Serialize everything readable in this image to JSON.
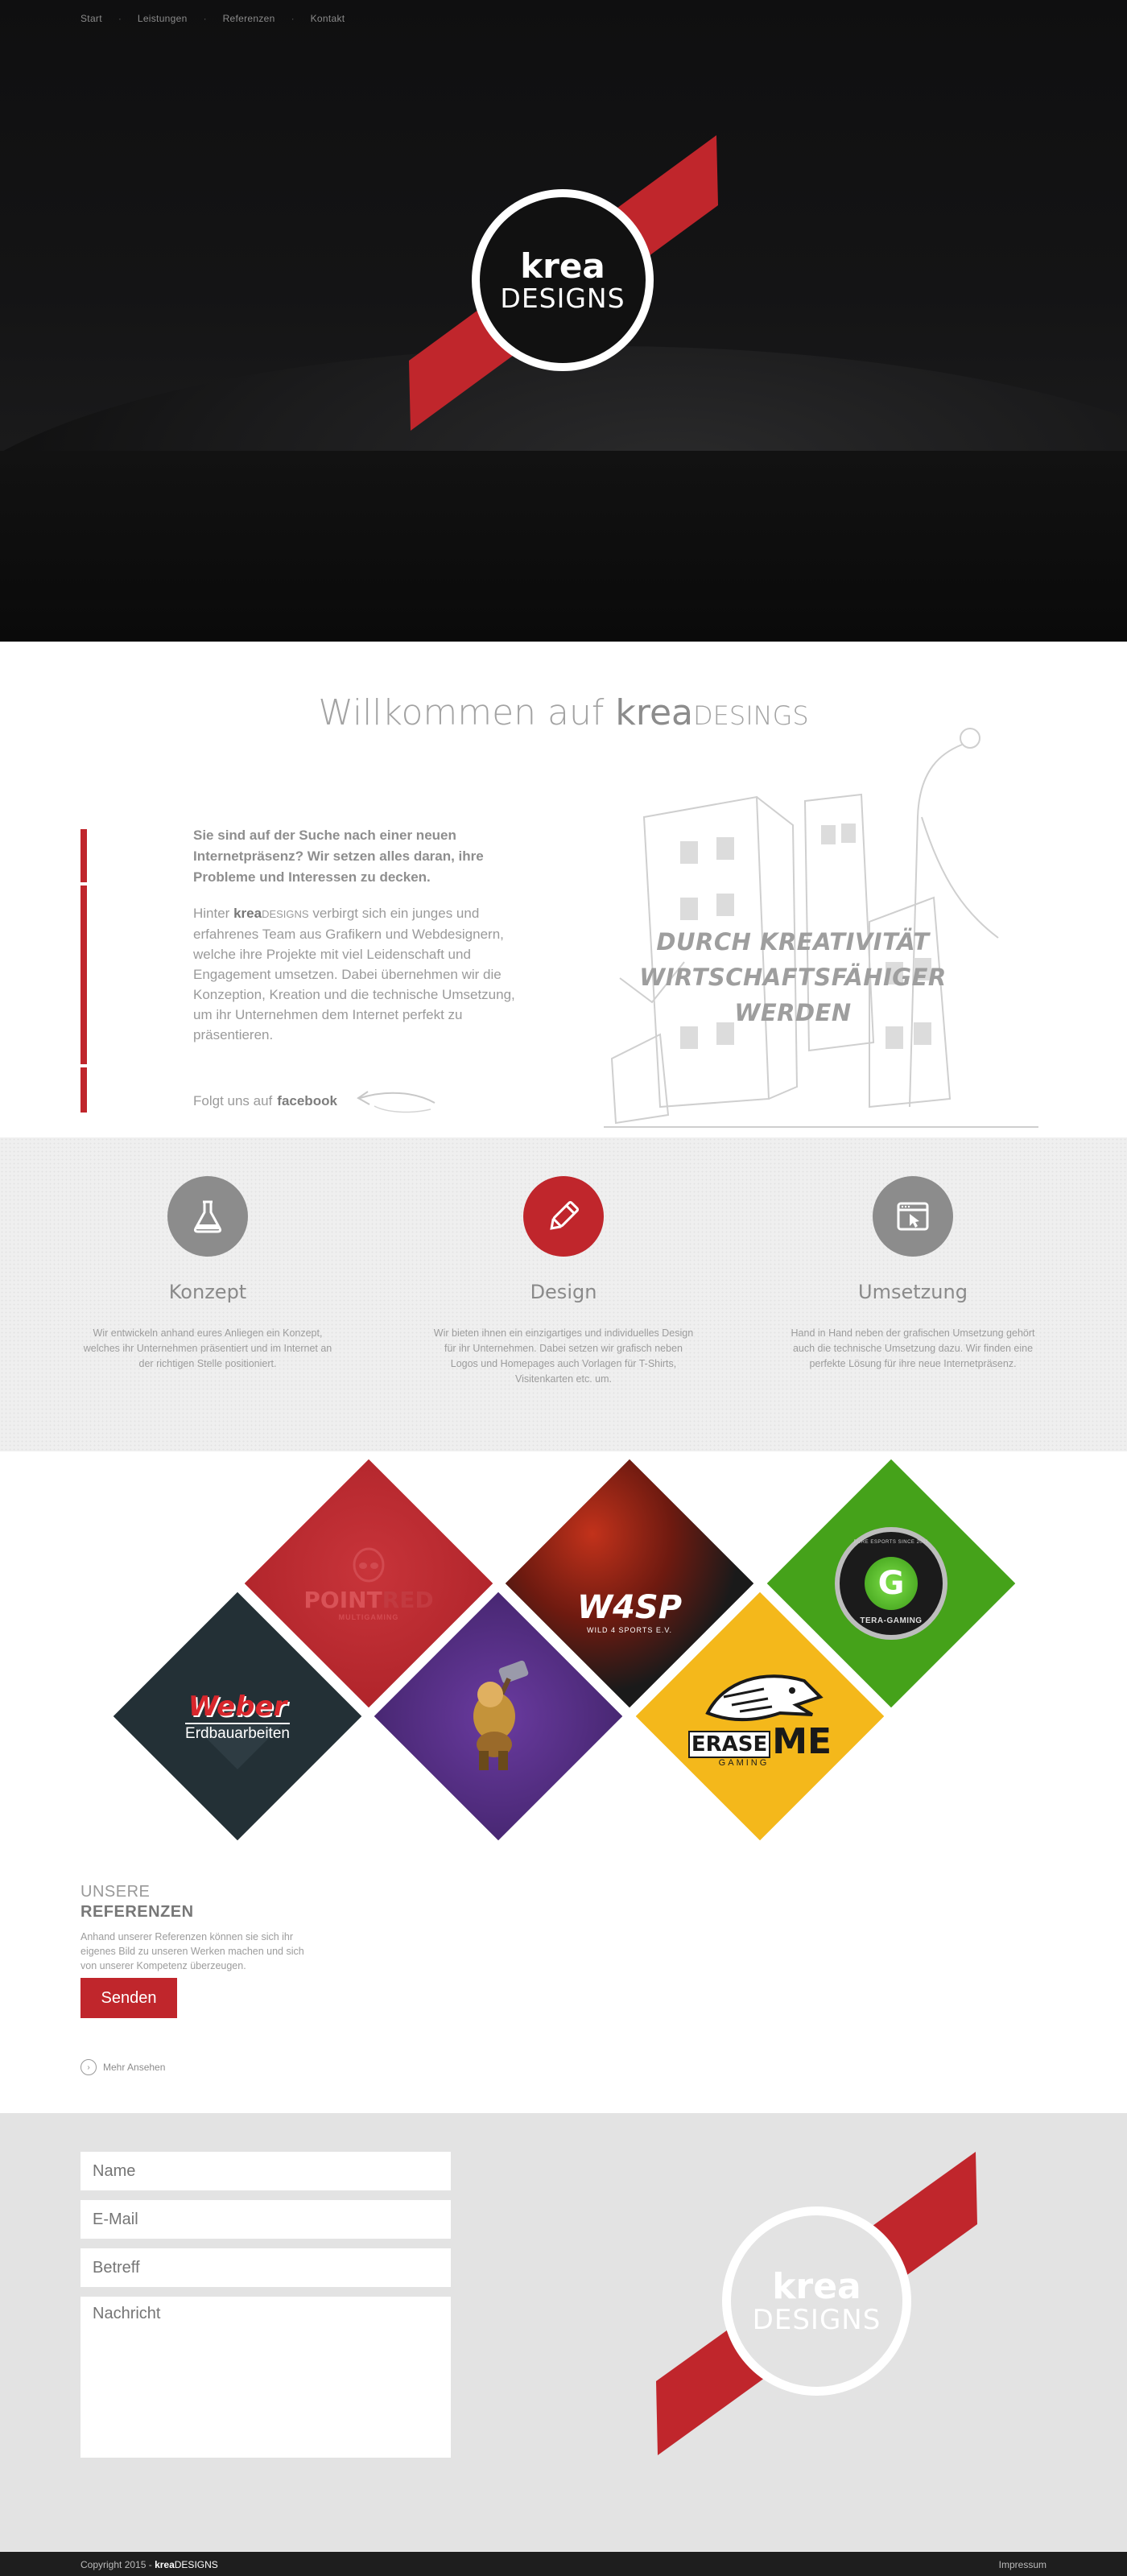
{
  "nav": {
    "items": [
      "Start",
      "Leistungen",
      "Referenzen",
      "Kontakt"
    ],
    "separator": "·"
  },
  "brand": {
    "word1": "krea",
    "word2": "DESIGNS",
    "accent_color": "#c0262c"
  },
  "welcome": {
    "title_prefix": "Willkommen auf",
    "title_brand_bold": "krea",
    "title_brand_light": "DESINGS",
    "intro_bold": "Sie sind auf der Suche nach einer neuen Internetpräsenz? Wir setzen alles daran, ihre Probleme und Interessen zu decken.",
    "text_prefix": "Hinter",
    "text_brand_bold": "krea",
    "text_brand_light": "DESIGNS",
    "text_rest": "verbirgt sich ein junges und erfahrenes Team aus Grafikern und Webdesignern, welche ihre Projekte mit viel Leidenschaft und Engagement umsetzen. Dabei übernehmen wir die Konzeption, Kreation und die technische Umsetzung, um ihr Unternehmen dem Internet perfekt zu präsentieren.",
    "follow_prefix": "Folgt uns auf",
    "follow_link": "facebook",
    "slogan_line1": "DURCH KREATIVITÄT",
    "slogan_line2": "WIRTSCHAFTSFÄHIGER WERDEN"
  },
  "services": [
    {
      "icon": "flask-icon",
      "title": "Konzept",
      "text": "Wir entwickeln anhand eures Anliegen ein Konzept, welches ihr Unternehmen präsentiert und im Internet an der richtigen Stelle positioniert."
    },
    {
      "icon": "pencil-icon",
      "title": "Design",
      "text": "Wir bieten ihnen ein einzigartiges und individuelles Design für ihr Unternehmen. Dabei setzen wir grafisch neben Logos und Homepages auch Vorlagen für T-Shirts, Visitenkarten etc. um."
    },
    {
      "icon": "browser-cursor-icon",
      "title": "Umsetzung",
      "text": "Hand in Hand neben der grafischen Umsetzung gehört auch die technische Umsetzung dazu. Wir finden eine perfekte Lösung für ihre neue Internetpräsenz."
    }
  ],
  "references": {
    "heading_light": "UNSERE",
    "heading_bold": "REFERENZEN",
    "text": "Anhand unserer Referenzen können sie sich ihr eigenes Bild zu unseren Werken machen und sich von unserer Kompetenz überzeugen.",
    "more_label": "Mehr Ansehen",
    "tiles": {
      "pointred": {
        "name": "POINTRED",
        "name_part1": "POINT",
        "name_part2": "RED",
        "sub": "MULTIGAMING",
        "bg": "#b8242a"
      },
      "wasp": {
        "name": "W4SP",
        "sub": "WILD 4 SPORTS E.V.",
        "bg": "#1d1d1d"
      },
      "tera": {
        "name": "TERA-GAMING",
        "ring": "PURE ESPORTS SINCE 2011",
        "letter": "G",
        "bg": "#45a21a"
      },
      "weber": {
        "name": "Weber",
        "sub": "Erdbauarbeiten",
        "bg": "#233036"
      },
      "figure": {
        "bg": "#4b2a77"
      },
      "erase": {
        "name_part1": "ERASE",
        "name_part2": "ME",
        "sub": "GAMING",
        "bg": "#f4b81b"
      }
    }
  },
  "contact": {
    "name_placeholder": "Name",
    "email_placeholder": "E-Mail",
    "subject_placeholder": "Betreff",
    "message_placeholder": "Nachricht",
    "send_label": "Senden"
  },
  "footer": {
    "copyright": "Copyright 2015 -",
    "brand_bold": "krea",
    "brand_light": "DESIGNS",
    "impressum": "Impressum"
  }
}
